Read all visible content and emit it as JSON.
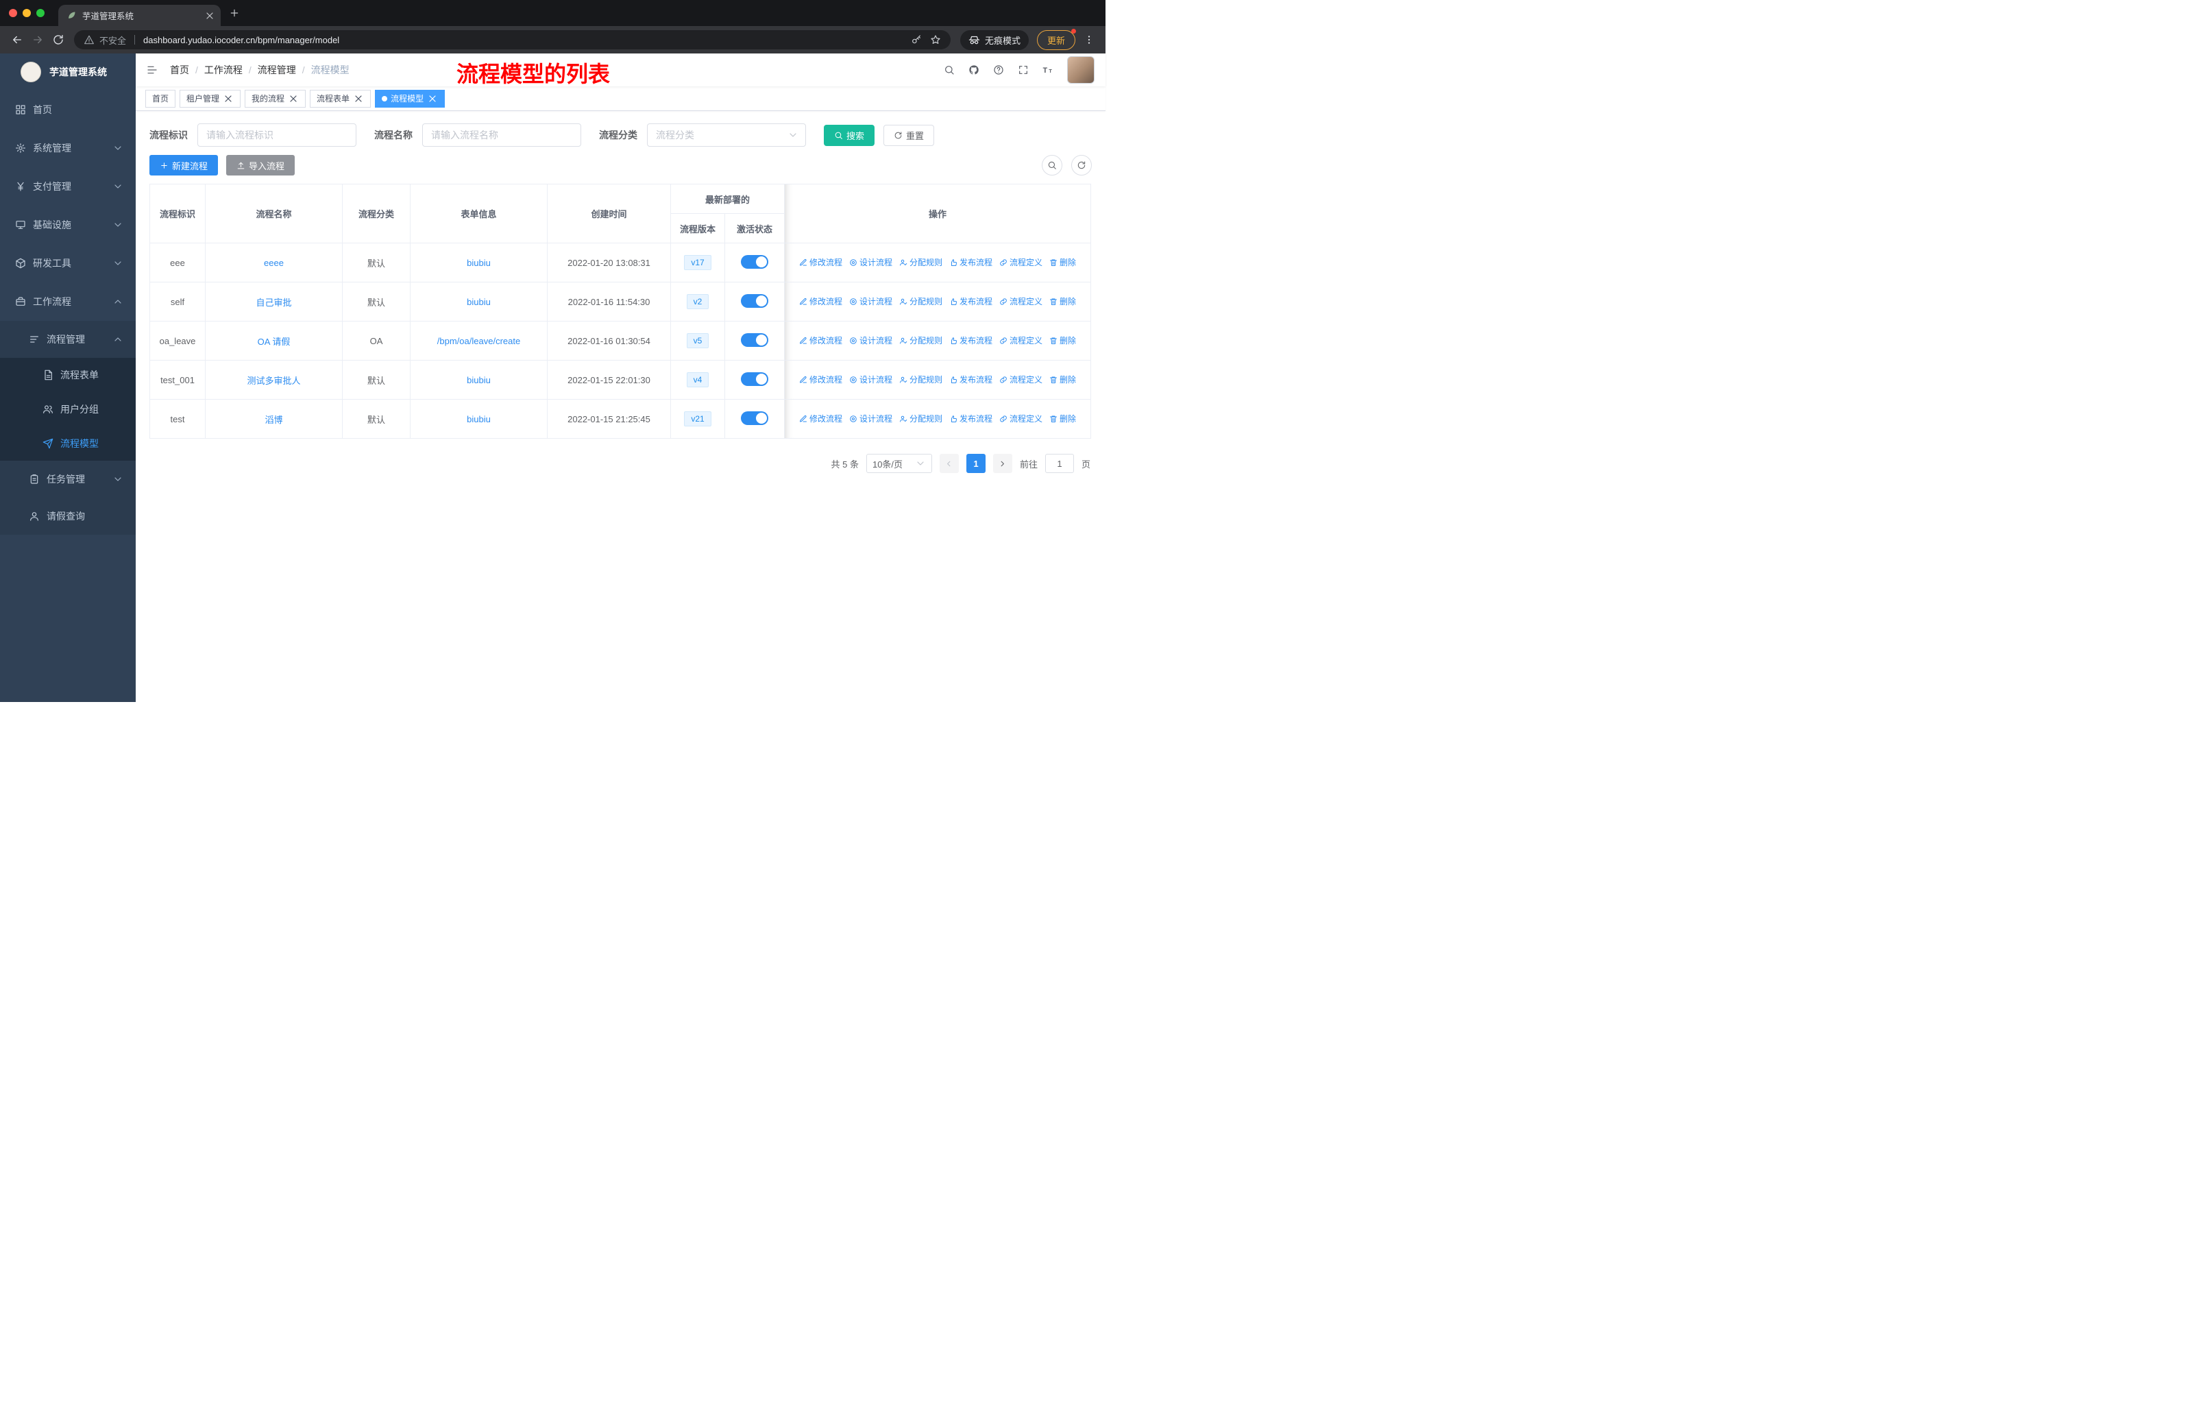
{
  "browser": {
    "tab_title": "芋道管理系统",
    "security_label": "不安全",
    "url": "dashboard.yudao.iocoder.cn/bpm/manager/model",
    "incognito_label": "无痕模式",
    "update_label": "更新"
  },
  "sidebar": {
    "title": "芋道管理系统",
    "items": [
      {
        "id": "home",
        "label": "首页",
        "icon": "dashboard-icon",
        "level": 1,
        "chevron": null,
        "active": false
      },
      {
        "id": "system",
        "label": "系统管理",
        "icon": "gear-icon",
        "level": 1,
        "chevron": "down",
        "active": false
      },
      {
        "id": "payment",
        "label": "支付管理",
        "icon": "yen-icon",
        "level": 1,
        "chevron": "down",
        "active": false
      },
      {
        "id": "infrastructure",
        "label": "基础设施",
        "icon": "monitor-icon",
        "level": 1,
        "chevron": "down",
        "active": false
      },
      {
        "id": "devtools",
        "label": "研发工具",
        "icon": "toolbox-icon",
        "level": 1,
        "chevron": "down",
        "active": false
      },
      {
        "id": "workflow",
        "label": "工作流程",
        "icon": "briefcase-icon",
        "level": 1,
        "chevron": "up",
        "active": false
      },
      {
        "id": "process-manage",
        "label": "流程管理",
        "icon": "list-icon",
        "level": 2,
        "chevron": "up",
        "active": false
      },
      {
        "id": "process-form",
        "label": "流程表单",
        "icon": "document-icon",
        "level": 3,
        "chevron": null,
        "active": false
      },
      {
        "id": "user-group",
        "label": "用户分组",
        "icon": "users-icon",
        "level": 3,
        "chevron": null,
        "active": false
      },
      {
        "id": "process-model",
        "label": "流程模型",
        "icon": "send-icon",
        "level": 3,
        "chevron": null,
        "active": true
      },
      {
        "id": "task-manage",
        "label": "任务管理",
        "icon": "clipboard-icon",
        "level": 2,
        "chevron": "down",
        "active": false
      },
      {
        "id": "leave-query",
        "label": "请假查询",
        "icon": "user-icon",
        "level": 2,
        "chevron": null,
        "active": false
      }
    ]
  },
  "navbar": {
    "breadcrumb": [
      "首页",
      "工作流程",
      "流程管理",
      "流程模型"
    ],
    "annotation": "流程模型的列表"
  },
  "tags": [
    {
      "id": "home",
      "label": "首页",
      "closable": false,
      "active": false
    },
    {
      "id": "tenant",
      "label": "租户管理",
      "closable": true,
      "active": false
    },
    {
      "id": "my-process",
      "label": "我的流程",
      "closable": true,
      "active": false
    },
    {
      "id": "process-form",
      "label": "流程表单",
      "closable": true,
      "active": false
    },
    {
      "id": "process-model",
      "label": "流程模型",
      "closable": true,
      "active": true
    }
  ],
  "filters": {
    "key_label": "流程标识",
    "key_placeholder": "请输入流程标识",
    "name_label": "流程名称",
    "name_placeholder": "请输入流程名称",
    "category_label": "流程分类",
    "category_placeholder": "流程分类",
    "search_label": "搜索",
    "reset_label": "重置"
  },
  "toolbar": {
    "create_label": "新建流程",
    "import_label": "导入流程"
  },
  "table": {
    "headers": {
      "key": "流程标识",
      "name": "流程名称",
      "category": "流程分类",
      "form": "表单信息",
      "created": "创建时间",
      "deploy_group": "最新部署的",
      "version": "流程版本",
      "status": "激活状态",
      "actions": "操作"
    },
    "action_labels": [
      "修改流程",
      "设计流程",
      "分配规则",
      "发布流程",
      "流程定义",
      "删除"
    ],
    "rows": [
      {
        "key": "eee",
        "name": "eeee",
        "category": "默认",
        "form": "biubiu",
        "created": "2022-01-20 13:08:31",
        "version": "v17",
        "active": true
      },
      {
        "key": "self",
        "name": "自己审批",
        "category": "默认",
        "form": "biubiu",
        "created": "2022-01-16 11:54:30",
        "version": "v2",
        "active": true
      },
      {
        "key": "oa_leave",
        "name": "OA 请假",
        "category": "OA",
        "form": "/bpm/oa/leave/create",
        "created": "2022-01-16 01:30:54",
        "version": "v5",
        "active": true
      },
      {
        "key": "test_001",
        "name": "测试多审批人",
        "category": "默认",
        "form": "biubiu",
        "created": "2022-01-15 22:01:30",
        "version": "v4",
        "active": true
      },
      {
        "key": "test",
        "name": "滔博",
        "category": "默认",
        "form": "biubiu",
        "created": "2022-01-15 21:25:45",
        "version": "v21",
        "active": true
      }
    ]
  },
  "pagination": {
    "total": "共 5 条",
    "page_size": "10条/页",
    "current": "1",
    "goto_label": "前往",
    "goto_value": "1",
    "unit_label": "页"
  },
  "colors": {
    "primary": "#2d8cf0",
    "search_button": "#18bc9c",
    "annotation": "#ff0000",
    "sidebar_background": "#304156"
  }
}
